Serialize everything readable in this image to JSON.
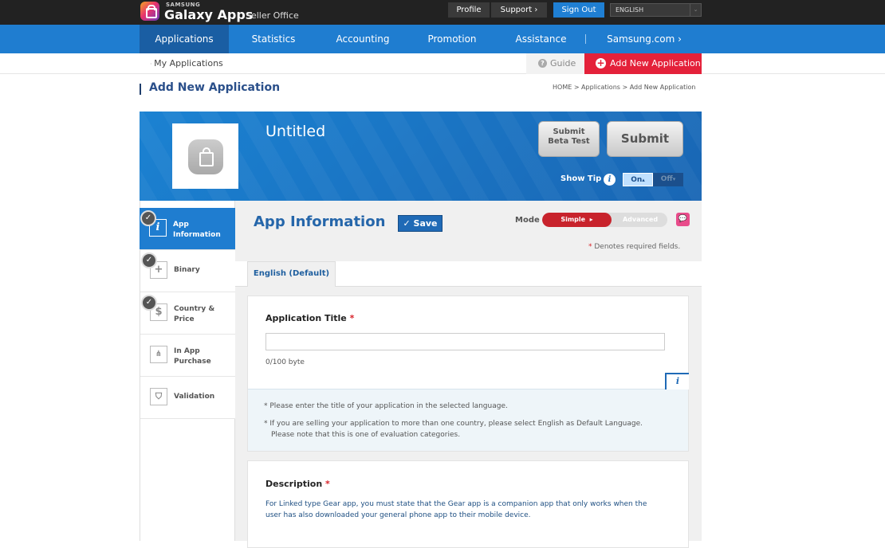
{
  "brand": {
    "small": "SAMSUNG",
    "name": "Galaxy Apps",
    "sub": "Seller Office"
  },
  "topbar": {
    "profile": "Profile",
    "support": "Support",
    "sign_out": "Sign Out",
    "language": "ENGLISH"
  },
  "nav": {
    "items": [
      "Applications",
      "Statistics",
      "Accounting",
      "Promotion",
      "Assistance",
      "Samsung.com"
    ],
    "active": "Applications"
  },
  "subnav": {
    "my_apps": "My Applications",
    "guide": "Guide",
    "add_new": "Add New Application"
  },
  "page": {
    "title": "Add New Application",
    "breadcrumb": "HOME  >  Applications  >  Add New Application"
  },
  "banner": {
    "app_title": "Untitled",
    "beta_line1": "Submit",
    "beta_line2": "Beta Test",
    "submit": "Submit",
    "show_tip": "Show Tip",
    "tip_on": "On",
    "tip_off": "Off"
  },
  "sidebar": {
    "items": [
      {
        "label": "App Information",
        "icon": "info-icon",
        "completed": true,
        "active": true
      },
      {
        "label": "Binary",
        "icon": "plus-icon",
        "completed": true,
        "active": false
      },
      {
        "label": "Country & Price",
        "icon": "dollar-icon",
        "completed": true,
        "active": false
      },
      {
        "label": "In App Purchase",
        "icon": "hierarchy-icon",
        "completed": false,
        "active": false
      },
      {
        "label": "Validation",
        "icon": "shield-icon",
        "completed": false,
        "active": false
      }
    ]
  },
  "content": {
    "title": "App Information",
    "save": "Save",
    "mode_label": "Mode",
    "mode_simple": "Simple",
    "mode_advanced": "Advanced",
    "required_note": "Denotes required fields.",
    "lang_tab": "English (Default)"
  },
  "app_title_field": {
    "label": "Application Title",
    "value": "",
    "byte_count": "0/100 byte",
    "tips": [
      "Please enter the title of your application in the selected language.",
      "If you are selling your application to more than one country, please select English as Default Language.",
      "Please note that this is one of evaluation categories."
    ]
  },
  "description_field": {
    "label": "Description",
    "note": "For Linked type Gear app, you must state that the Gear app is a companion app that only works when the user has also downloaded your general phone app to their mobile device."
  },
  "colors": {
    "nav_blue": "#1f7dd0",
    "add_red": "#e4213a",
    "title_blue": "#2566aa"
  }
}
